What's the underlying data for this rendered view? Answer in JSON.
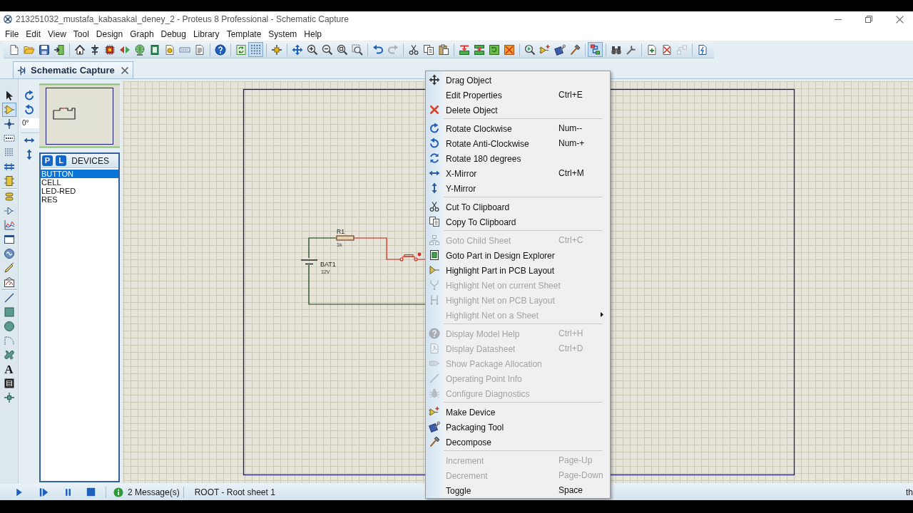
{
  "window": {
    "title": "213251032_mustafa_kabasakal_deney_2 - Proteus 8 Professional - Schematic Capture"
  },
  "menu_bar": [
    "File",
    "Edit",
    "View",
    "Tool",
    "Design",
    "Graph",
    "Debug",
    "Library",
    "Template",
    "System",
    "Help"
  ],
  "toolbar": [
    [
      {
        "kind": "new",
        "pressed": false,
        "disabled": false
      },
      {
        "kind": "open",
        "pressed": false,
        "disabled": false
      },
      {
        "kind": "save",
        "pressed": false,
        "disabled": false
      },
      {
        "kind": "import",
        "pressed": false,
        "disabled": false
      }
    ],
    [
      {
        "kind": "home",
        "pressed": false,
        "disabled": false
      },
      {
        "kind": "schematic",
        "pressed": false,
        "disabled": false
      },
      {
        "kind": "pcb",
        "pressed": false,
        "disabled": false
      },
      {
        "kind": "view_3d",
        "pressed": false,
        "disabled": false
      },
      {
        "kind": "gerber",
        "pressed": false,
        "disabled": false
      },
      {
        "kind": "bom",
        "pressed": false,
        "disabled": false
      },
      {
        "kind": "cost",
        "pressed": false,
        "disabled": false
      },
      {
        "kind": "notes",
        "pressed": false,
        "disabled": false
      },
      {
        "kind": "report",
        "pressed": false,
        "disabled": false
      }
    ],
    [
      {
        "kind": "help",
        "pressed": false,
        "disabled": false
      }
    ],
    [
      {
        "kind": "refresh",
        "pressed": false,
        "disabled": false
      },
      {
        "kind": "grid",
        "pressed": true,
        "disabled": false
      }
    ],
    [
      {
        "kind": "origin",
        "pressed": false,
        "disabled": false
      }
    ],
    [
      {
        "kind": "pan",
        "pressed": false,
        "disabled": false
      },
      {
        "kind": "zoom_in",
        "pressed": false,
        "disabled": false
      },
      {
        "kind": "zoom_out",
        "pressed": false,
        "disabled": false
      },
      {
        "kind": "zoom_all",
        "pressed": false,
        "disabled": false
      },
      {
        "kind": "zoom_area",
        "pressed": false,
        "disabled": false
      }
    ],
    [
      {
        "kind": "undo",
        "pressed": false,
        "disabled": false
      },
      {
        "kind": "redo",
        "pressed": false,
        "disabled": true
      }
    ],
    [
      {
        "kind": "cut",
        "pressed": false,
        "disabled": false
      },
      {
        "kind": "copy",
        "pressed": false,
        "disabled": false
      },
      {
        "kind": "paste",
        "pressed": false,
        "disabled": false
      }
    ],
    [
      {
        "kind": "block_copy",
        "pressed": false,
        "disabled": false
      },
      {
        "kind": "block_move",
        "pressed": false,
        "disabled": false
      },
      {
        "kind": "block_rotate",
        "pressed": false,
        "disabled": false
      },
      {
        "kind": "block_delete",
        "pressed": false,
        "disabled": false
      }
    ],
    [
      {
        "kind": "pick_parts",
        "pressed": false,
        "disabled": false
      },
      {
        "kind": "make_device",
        "pressed": false,
        "disabled": false
      },
      {
        "kind": "packaging",
        "pressed": false,
        "disabled": false
      },
      {
        "kind": "decompose",
        "pressed": false,
        "disabled": false
      }
    ],
    [
      {
        "kind": "autoroute",
        "pressed": true,
        "disabled": false
      }
    ],
    [
      {
        "kind": "search",
        "pressed": false,
        "disabled": false
      },
      {
        "kind": "property_tool",
        "pressed": false,
        "disabled": false
      }
    ],
    [
      {
        "kind": "new_sheet",
        "pressed": false,
        "disabled": false
      },
      {
        "kind": "remove_sheet",
        "pressed": false,
        "disabled": false
      },
      {
        "kind": "exit_sheet",
        "pressed": false,
        "disabled": true
      }
    ],
    [
      {
        "kind": "erc",
        "pressed": false,
        "disabled": false
      }
    ]
  ],
  "tabs": [
    {
      "label": "Schematic Capture",
      "selected": true
    }
  ],
  "mode_tools": [
    [
      {
        "kind": "select",
        "selected": false
      },
      {
        "kind": "component",
        "selected": true
      },
      {
        "kind": "junction",
        "selected": false
      },
      {
        "kind": "label",
        "selected": false
      },
      {
        "kind": "script",
        "selected": false
      },
      {
        "kind": "bus",
        "selected": false
      },
      {
        "kind": "subcircuit",
        "selected": false
      }
    ],
    [
      {
        "kind": "terminal",
        "selected": false
      },
      {
        "kind": "pin",
        "selected": false
      },
      {
        "kind": "graph",
        "selected": false
      },
      {
        "kind": "tape",
        "selected": false
      },
      {
        "kind": "generator",
        "selected": false
      },
      {
        "kind": "probe",
        "selected": false
      },
      {
        "kind": "instrument",
        "selected": false
      }
    ],
    [
      {
        "kind": "line",
        "selected": false
      },
      {
        "kind": "box",
        "selected": false
      },
      {
        "kind": "circle",
        "selected": false
      },
      {
        "kind": "arc",
        "selected": false
      },
      {
        "kind": "path",
        "selected": false
      },
      {
        "kind": "text",
        "glyph": "A",
        "selected": false
      },
      {
        "kind": "symbol",
        "selected": false
      },
      {
        "kind": "marker",
        "selected": false
      }
    ]
  ],
  "orientation_tools": {
    "rotate": [
      {
        "kind": "rotate_cw"
      },
      {
        "kind": "rotate_acw"
      }
    ],
    "angle": "0°",
    "mirror": [
      {
        "kind": "mirror_x"
      },
      {
        "kind": "mirror_y"
      }
    ]
  },
  "devices": {
    "buttons": [
      "P",
      "L"
    ],
    "title": "DEVICES",
    "items": [
      {
        "label": "BUTTON",
        "selected": true
      },
      {
        "label": "CELL",
        "selected": false
      },
      {
        "label": "LED-RED",
        "selected": false
      },
      {
        "label": "RES",
        "selected": false
      }
    ]
  },
  "schematic": {
    "components": [
      {
        "kind": "resistor",
        "ref": "R1",
        "value": "1k",
        "selected": false
      },
      {
        "kind": "battery",
        "ref": "BAT1",
        "value": "12V",
        "selected": false
      },
      {
        "kind": "push_button",
        "selected": true
      }
    ],
    "wires": [
      {
        "selected": false
      },
      {
        "selected": true
      },
      {
        "selected": false
      }
    ]
  },
  "context_menu": {
    "groups": [
      [
        {
          "kind": "drag",
          "label": "Drag Object",
          "disabled": false,
          "submenu": false
        },
        {
          "kind": "plain",
          "label": "Edit Properties",
          "shortcut": "Ctrl+E",
          "disabled": false,
          "submenu": false
        },
        {
          "kind": "delete",
          "label": "Delete Object",
          "disabled": false,
          "submenu": false
        }
      ],
      [
        {
          "kind": "rotate_cw",
          "label": "Rotate Clockwise",
          "shortcut": "Num--",
          "disabled": false,
          "submenu": false
        },
        {
          "kind": "rotate_acw",
          "label": "Rotate Anti-Clockwise",
          "shortcut": "Num-+",
          "disabled": false,
          "submenu": false
        },
        {
          "kind": "rotate_180",
          "label": "Rotate 180 degrees",
          "disabled": false,
          "submenu": false
        },
        {
          "kind": "mirror_x",
          "label": "X-Mirror",
          "shortcut": "Ctrl+M",
          "disabled": false,
          "submenu": false
        },
        {
          "kind": "mirror_y",
          "label": "Y-Mirror",
          "disabled": false,
          "submenu": false
        }
      ],
      [
        {
          "kind": "cut",
          "label": "Cut To Clipboard",
          "disabled": false,
          "submenu": false
        },
        {
          "kind": "copy",
          "label": "Copy To Clipboard",
          "disabled": false,
          "submenu": false
        }
      ],
      [
        {
          "kind": "child_sheet",
          "label": "Goto Child Sheet",
          "shortcut": "Ctrl+C",
          "disabled": true,
          "submenu": false
        },
        {
          "kind": "goto_part",
          "label": "Goto Part in Design Explorer",
          "disabled": false,
          "submenu": false
        },
        {
          "kind": "highlight_part",
          "label": "Highlight Part in PCB Layout",
          "disabled": false,
          "submenu": false
        },
        {
          "kind": "net_current",
          "label": "Highlight Net on current Sheet",
          "disabled": true,
          "submenu": false
        },
        {
          "kind": "net_pcb",
          "label": "Highlight Net on PCB Layout",
          "disabled": true,
          "submenu": false
        },
        {
          "kind": "plain",
          "label": "Highlight Net on a Sheet",
          "disabled": true,
          "submenu": true
        }
      ],
      [
        {
          "kind": "model_help",
          "label": "Display Model Help",
          "shortcut": "Ctrl+H",
          "disabled": true,
          "submenu": false
        },
        {
          "kind": "datasheet",
          "label": "Display Datasheet",
          "shortcut": "Ctrl+D",
          "disabled": true,
          "submenu": false
        },
        {
          "kind": "show_package",
          "label": "Show Package Allocation",
          "disabled": true,
          "submenu": false
        },
        {
          "kind": "op_point",
          "label": "Operating Point Info",
          "disabled": true,
          "submenu": false
        },
        {
          "kind": "diagnostics",
          "label": "Configure Diagnostics",
          "disabled": true,
          "submenu": false
        }
      ],
      [
        {
          "kind": "make_device",
          "label": "Make Device",
          "disabled": false,
          "submenu": false
        },
        {
          "kind": "packaging",
          "label": "Packaging Tool",
          "disabled": false,
          "submenu": false
        },
        {
          "kind": "decompose",
          "label": "Decompose",
          "disabled": false,
          "submenu": false
        }
      ],
      [
        {
          "kind": "plain",
          "label": "Increment",
          "shortcut": "Page-Up",
          "disabled": true,
          "submenu": false
        },
        {
          "kind": "plain",
          "label": "Decrement",
          "shortcut": "Page-Down",
          "disabled": true,
          "submenu": false
        },
        {
          "kind": "plain",
          "label": "Toggle",
          "shortcut": "Space",
          "disabled": false,
          "submenu": false
        }
      ]
    ]
  },
  "status_bar": {
    "controls": [
      {
        "kind": "play"
      },
      {
        "kind": "step"
      },
      {
        "kind": "pause"
      },
      {
        "kind": "stop"
      }
    ],
    "messages": "2 Message(s)",
    "sheet": "ROOT - Root sheet 1",
    "edge_text": "th"
  }
}
